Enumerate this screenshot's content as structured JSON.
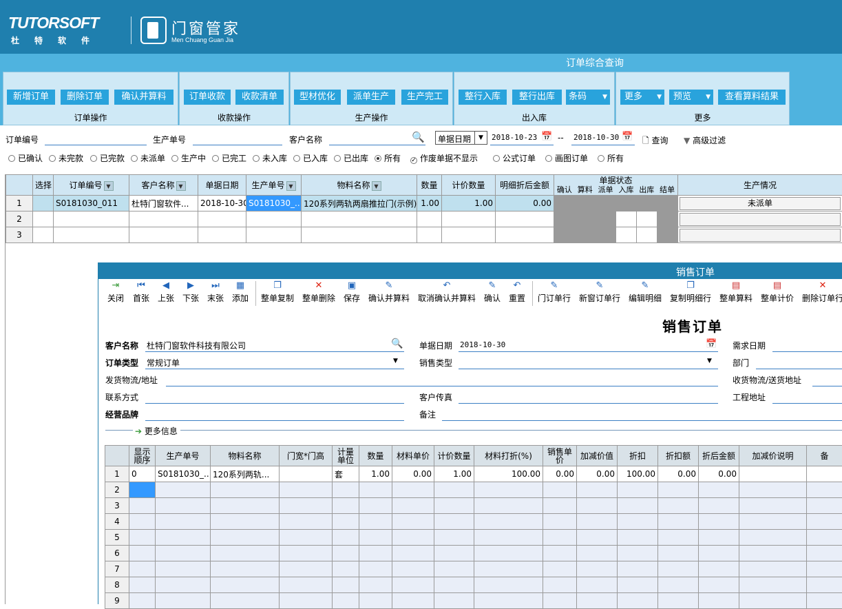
{
  "header": {
    "logo_text": "TUTORSOFT",
    "logo_sub": "杜特软件",
    "product_cn": "门窗管家",
    "product_en": "Men Chuang Guan Jia"
  },
  "panel_title": "订单综合查询",
  "ribbon": {
    "groups": [
      {
        "label": "订单操作",
        "buttons": [
          "新增订单",
          "删除订单",
          "确认并算料"
        ]
      },
      {
        "label": "收款操作",
        "buttons": [
          "订单收款",
          "收款清单"
        ]
      },
      {
        "label": "生产操作",
        "buttons": [
          "型材优化",
          "派单生产",
          "生产完工"
        ]
      },
      {
        "label": "出入库",
        "buttons": [
          "整行入库",
          "整行出库",
          "条码"
        ]
      },
      {
        "label": "更多",
        "buttons": [
          "更多",
          "预览",
          "查看算料结果"
        ]
      }
    ]
  },
  "filters": {
    "order_no_label": "订单编号",
    "production_no_label": "生产单号",
    "customer_label": "客户名称",
    "date_type": "单据日期",
    "date_from": "2018-10-23",
    "date_sep": "--",
    "date_to": "2018-10-30",
    "query_label": "查询",
    "advanced_label": "高级过滤"
  },
  "status_radios": [
    "已确认",
    "未完款",
    "已完款",
    "未派单",
    "生产中",
    "已完工",
    "未入库",
    "已入库",
    "已出库",
    "所有"
  ],
  "status_selected": "所有",
  "hide_void_label": "作废单据不显示",
  "hide_void_checked": true,
  "type_radios": [
    "公式订单",
    "画图订单",
    "所有"
  ],
  "grid1": {
    "headers": [
      "选择",
      "订单编号",
      "客户名称",
      "单据日期",
      "生产单号",
      "物料名称",
      "数量",
      "计价数量",
      "明细折后金额",
      "单据状态",
      "生产情况"
    ],
    "status_sub": [
      "确认",
      "算料",
      "派单",
      "入库",
      "出库",
      "结单"
    ],
    "rows": [
      {
        "n": "1",
        "order_no": "S0181030_011",
        "customer": "杜特门窗软件...",
        "date": "2018-10-30",
        "prod_no": "S0181030_...",
        "material": "120系列两轨两扇推拉门(示例)",
        "qty": "1.00",
        "price_qty": "1.00",
        "amount": "0.00",
        "production": "未派单"
      },
      {
        "n": "2"
      },
      {
        "n": "3"
      }
    ]
  },
  "sales_order": {
    "window_title": "销售订单",
    "toolbar": [
      "关闭",
      "首张",
      "上张",
      "下张",
      "末张",
      "添加",
      "整单复制",
      "整单删除",
      "保存",
      "确认并算料",
      "取消确认并算料",
      "确认",
      "重置",
      "门订单行",
      "新窗订单行",
      "编辑明细",
      "复制明细行",
      "整单算料",
      "整单计价",
      "删除订单行"
    ],
    "title": "销售订单",
    "customer_label": "客户名称",
    "customer": "杜特门窗软件科技有限公司",
    "doc_date_label": "单据日期",
    "doc_date": "2018-10-30",
    "need_date_label": "需求日期",
    "order_type_label": "订单类型",
    "order_type": "常规订单",
    "sales_type_label": "销售类型",
    "dept_label": "部门",
    "ship_label": "发货物流/地址",
    "receive_label": "收货物流/送货地址",
    "contact_label": "联系方式",
    "fax_label": "客户传真",
    "project_label": "工程地址",
    "brand_label": "经营品牌",
    "remark_label": "备注",
    "more_label": "更多信息"
  },
  "grid2": {
    "headers": [
      "显示\n顺序",
      "生产单号",
      "物料名称",
      "门宽*门高",
      "计量\n单位",
      "数量",
      "材料单价",
      "计价数量",
      "材料打折(%)",
      "销售单\n价",
      "加减价值",
      "折扣",
      "折扣额",
      "折后金额",
      "加减价说明",
      "备"
    ],
    "rows": [
      {
        "n": "1",
        "order": "0",
        "prod_no": "S0181030_...",
        "material": "120系列两轨...",
        "size": "",
        "unit": "套",
        "qty": "1.00",
        "mat_price": "0.00",
        "price_qty": "1.00",
        "discount_pct": "100.00",
        "unit_price": "0.00",
        "adj": "0.00",
        "discount": "100.00",
        "discount_amt": "0.00",
        "after": "0.00"
      },
      {
        "n": "2"
      },
      {
        "n": "3"
      },
      {
        "n": "4"
      },
      {
        "n": "5"
      },
      {
        "n": "6"
      },
      {
        "n": "7"
      },
      {
        "n": "8"
      },
      {
        "n": "9"
      }
    ]
  },
  "colors": {
    "brand": "#1f7fae",
    "ribbon": "#4fb3df",
    "button": "#29a3dc"
  }
}
